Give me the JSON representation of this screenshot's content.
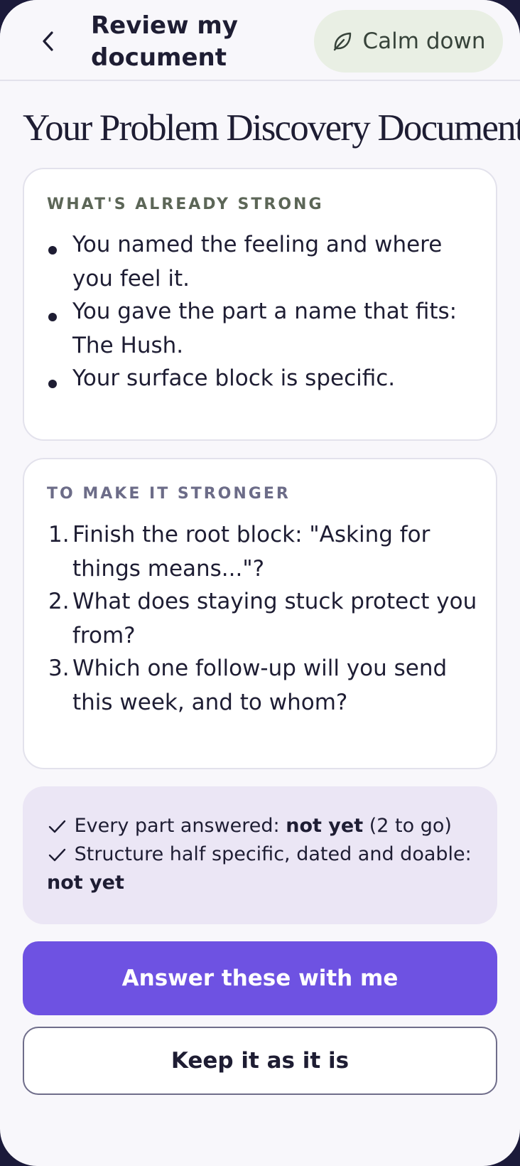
{
  "header": {
    "title": "Review my document",
    "calm_label": "Calm down"
  },
  "page_title": "Your Problem Discovery Document",
  "strong_card": {
    "heading": "WHAT'S ALREADY STRONG",
    "items": [
      "You named the feeling and where you feel it.",
      "You gave the part a name that fits: The Hush.",
      "Your surface block is specific."
    ]
  },
  "stronger_card": {
    "heading": "TO MAKE IT STRONGER",
    "items": [
      {
        "number": "1.",
        "text": "Finish the root block: \"Asking for things means...\"?"
      },
      {
        "number": "2.",
        "text": "What does staying stuck protect you from?"
      },
      {
        "number": "3.",
        "text": "Which one follow-up will you send this week, and to whom?"
      }
    ]
  },
  "status": {
    "line1_label": "Every part answered:",
    "line1_value": "not yet",
    "line1_extra": "(2 to go)",
    "line2_label": "Structure half specific, dated and doable:",
    "line2_value": "not yet"
  },
  "buttons": {
    "primary": "Answer these with me",
    "secondary": "Keep it as it is"
  },
  "colors": {
    "accent": "#6e52e2",
    "calm_bg": "#e9efe4",
    "status_bg": "#ebe6f5"
  }
}
